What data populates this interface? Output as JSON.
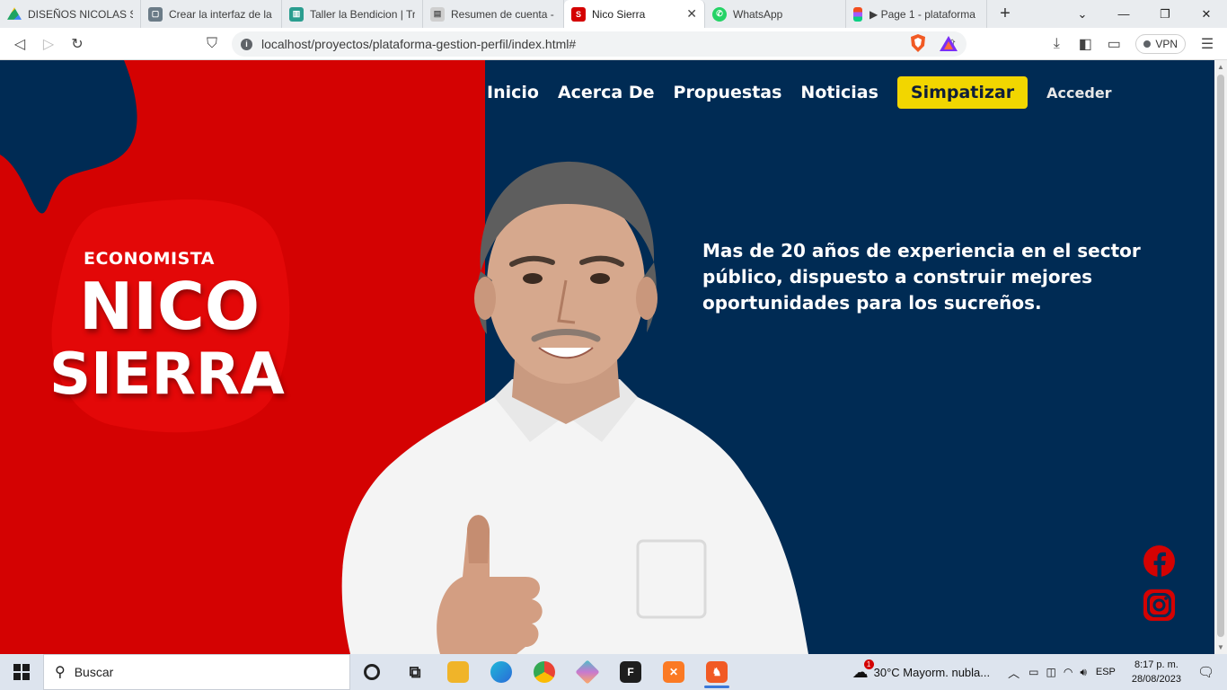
{
  "browser": {
    "tabs": [
      {
        "label": "DISEÑOS NICOLAS SIE",
        "icon": "google-drive-icon",
        "color": "#1fa463"
      },
      {
        "label": "Crear la interfaz de la s",
        "icon": "classroom-icon",
        "color": "#6b7b87"
      },
      {
        "label": "Taller la Bendicion | Tre",
        "icon": "trello-icon",
        "color": "#2a9d8f"
      },
      {
        "label": "Resumen de cuenta - N",
        "icon": "bank-icon",
        "color": "#8a8a8a"
      },
      {
        "label": "Nico Sierra",
        "icon": "site-icon",
        "color": "#d40202",
        "active": true
      },
      {
        "label": "WhatsApp",
        "icon": "whatsapp-icon",
        "color": "#25d366"
      },
      {
        "label": "▶ Page 1 - plataforma",
        "icon": "figma-icon",
        "color": "#f24e1e"
      }
    ],
    "url": "localhost/proyectos/plataforma-gestion-perfil/index.html#",
    "vpn_label": "VPN"
  },
  "site": {
    "nav": {
      "inicio": "Inicio",
      "acerca": "Acerca De",
      "propuestas": "Propuestas",
      "noticias": "Noticias",
      "simpatizar": "Simpatizar",
      "acceder": "Acceder"
    },
    "role": "ECONOMISTA",
    "first_name": "NICO",
    "last_name": "SIERRA",
    "tagline": "Mas de 20 años de experiencia en el sector público, dispuesto a construir mejores oportunidades para los sucreños.",
    "colors": {
      "red": "#d40202",
      "navy": "#002b54",
      "yellow": "#f2d600"
    }
  },
  "taskbar": {
    "search_placeholder": "Buscar",
    "weather": "30°C  Mayorm. nubla...",
    "weather_badge": "1",
    "language": "ESP",
    "time": "8:17 p. m.",
    "date": "28/08/2023"
  }
}
